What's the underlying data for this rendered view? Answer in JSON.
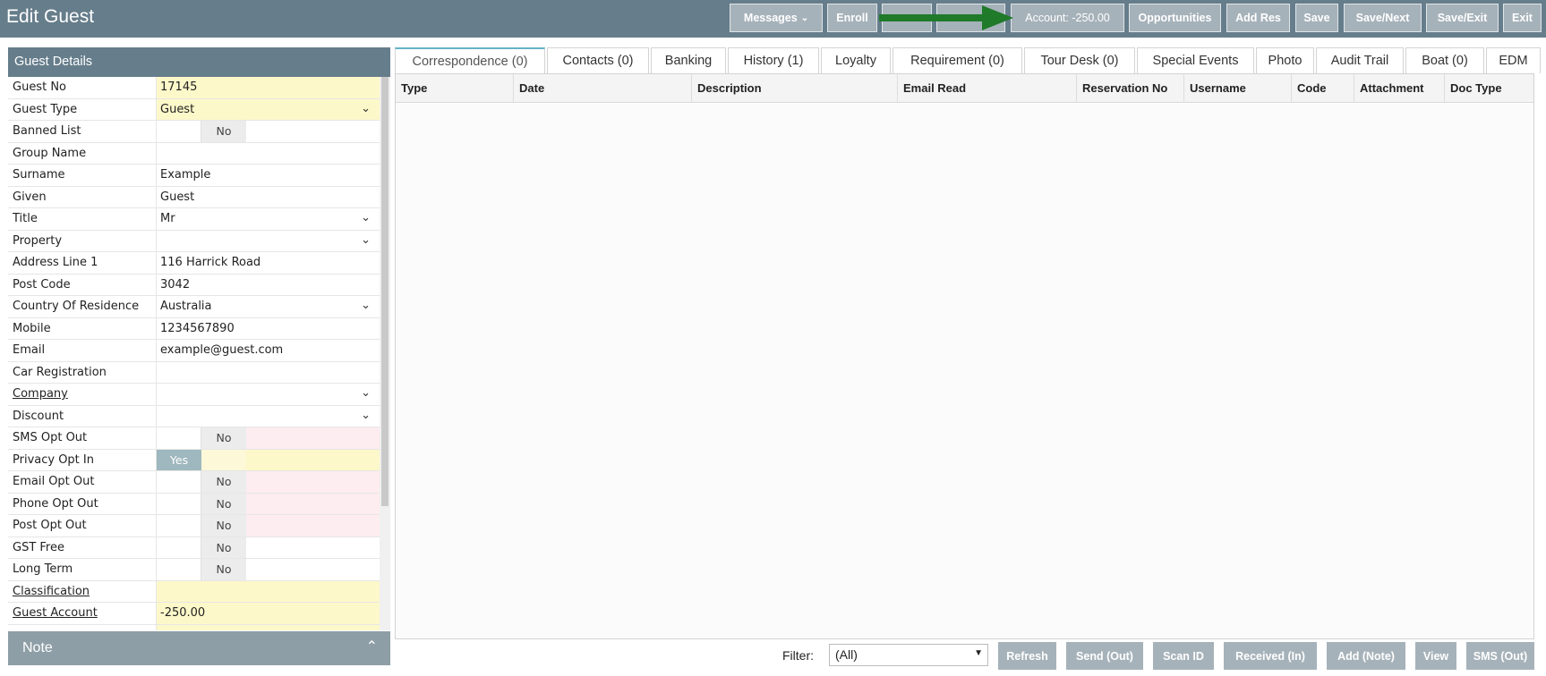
{
  "header": {
    "title": "Edit Guest",
    "buttons": {
      "messages": "Messages",
      "enroll": "Enroll",
      "blank1": "",
      "blank2": "",
      "account": "Account: -250.00",
      "opportunities": "Opportunities",
      "add_res": "Add Res",
      "save": "Save",
      "save_next": "Save/Next",
      "save_exit": "Save/Exit",
      "exit": "Exit"
    },
    "arrow_color": "#1f7a2a"
  },
  "guest_details": {
    "title": "Guest Details",
    "fields": [
      {
        "label": "Guest No",
        "value": "17145"
      },
      {
        "label": "Guest Type",
        "value": "Guest"
      },
      {
        "label": "Banned List",
        "value": "No"
      },
      {
        "label": "Group Name",
        "value": ""
      },
      {
        "label": "Surname",
        "value": "Example"
      },
      {
        "label": "Given",
        "value": "Guest"
      },
      {
        "label": "Title",
        "value": "Mr"
      },
      {
        "label": "Property",
        "value": ""
      },
      {
        "label": "Address Line 1",
        "value": "116 Harrick Road"
      },
      {
        "label": "Post Code",
        "value": "3042"
      },
      {
        "label": "Country Of Residence",
        "value": "Australia"
      },
      {
        "label": "Mobile",
        "value": "1234567890"
      },
      {
        "label": "Email",
        "value": "example@guest.com"
      },
      {
        "label": "Car Registration",
        "value": ""
      },
      {
        "label": "Company",
        "value": ""
      },
      {
        "label": "Discount",
        "value": ""
      },
      {
        "label": "SMS Opt Out",
        "value": "No"
      },
      {
        "label": "Privacy Opt In",
        "value": "Yes"
      },
      {
        "label": "Email Opt Out",
        "value": "No"
      },
      {
        "label": "Phone Opt Out",
        "value": "No"
      },
      {
        "label": "Post Opt Out",
        "value": "No"
      },
      {
        "label": "GST Free",
        "value": "No"
      },
      {
        "label": "Long Term",
        "value": "No"
      },
      {
        "label": "Classification",
        "value": ""
      },
      {
        "label": "Guest Account",
        "value": "-250.00"
      }
    ]
  },
  "note": {
    "label": "Note"
  },
  "tabs": [
    "Correspondence (0)",
    "Contacts (0)",
    "Banking",
    "History (1)",
    "Loyalty",
    "Requirement (0)",
    "Tour Desk (0)",
    "Special Events",
    "Photo",
    "Audit Trail",
    "Boat (0)",
    "EDM"
  ],
  "grid": {
    "columns": [
      "Type",
      "Date",
      "Description",
      "Email Read",
      "Reservation No",
      "Username",
      "Code",
      "Attachment",
      "Doc Type"
    ]
  },
  "footer": {
    "filter_label": "Filter:",
    "filter_value": "(All)",
    "buttons": {
      "refresh": "Refresh",
      "send_out": "Send (Out)",
      "scan_id": "Scan ID",
      "received_in": "Received (In)",
      "add_note": "Add (Note)",
      "view": "View",
      "sms_out": "SMS (Out)"
    }
  },
  "colors": {
    "header_bg": "#667d8b",
    "button_bg": "#a6b2ba",
    "required_yellow": "#fdf8c9",
    "optout_pink": "#fdecf0",
    "active_tab": "#64b2c8"
  }
}
